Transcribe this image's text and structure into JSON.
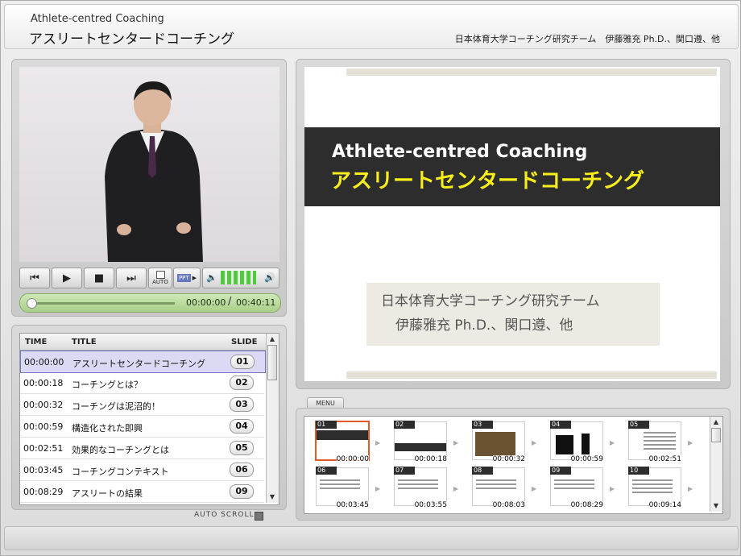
{
  "header": {
    "title_en": "Athlete-centred Coaching",
    "title_jp": "アスリートセンタードコーチング",
    "authors": "日本体育大学コーチング研究チーム　伊藤雅充 Ph.D.、関口遵、他"
  },
  "player": {
    "buttons": {
      "auto": "AUTO",
      "ppt": "PPT"
    },
    "progress": 0.0,
    "current_time": "00:00:00",
    "separator": "/",
    "total_time": "00:40:11"
  },
  "chapter_list": {
    "headers": {
      "time": "TIME",
      "title": "TITLE",
      "slide": "SLIDE"
    },
    "rows": [
      {
        "time": "00:00:00",
        "title": "アスリートセンタードコーチング",
        "slide": "01"
      },
      {
        "time": "00:00:18",
        "title": "コーチングとは？",
        "slide": "02"
      },
      {
        "time": "00:00:32",
        "title": "コーチングは泥沼的！",
        "slide": "03"
      },
      {
        "time": "00:00:59",
        "title": "構造化された即興",
        "slide": "04"
      },
      {
        "time": "00:02:51",
        "title": "効果的なコーチングとは",
        "slide": "05"
      },
      {
        "time": "00:03:45",
        "title": "コーチングコンテキスト",
        "slide": "06"
      },
      {
        "time": "00:08:29",
        "title": "アスリートの結果",
        "slide": "09"
      }
    ],
    "auto_scroll_label": "AUTO SCROLL"
  },
  "slide": {
    "title_en": "Athlete-centred Coaching",
    "title_jp": "アスリートセンタードコーチング",
    "subtitle_1": "日本体育大学コーチング研究チーム",
    "subtitle_2": "伊藤雅充 Ph.D.、関口遵、他"
  },
  "menu": {
    "tab_label": "MENU",
    "thumbnails": [
      {
        "num": "01",
        "time": "00:00:00"
      },
      {
        "num": "02",
        "time": "00:00:18"
      },
      {
        "num": "03",
        "time": "00:00:32"
      },
      {
        "num": "04",
        "time": "00:00:59"
      },
      {
        "num": "05",
        "time": "00:02:51"
      },
      {
        "num": "06",
        "time": "00:03:45"
      },
      {
        "num": "07",
        "time": "00:03:55"
      },
      {
        "num": "08",
        "time": "00:08:03"
      },
      {
        "num": "09",
        "time": "00:08:29"
      },
      {
        "num": "10",
        "time": "00:09:14"
      }
    ]
  },
  "colors": {
    "accent_yellow": "#f7ee1b",
    "selected_row": "#dcd9f4",
    "seek_green": "#a8cf88",
    "selected_thumb": "#e05a2a"
  }
}
